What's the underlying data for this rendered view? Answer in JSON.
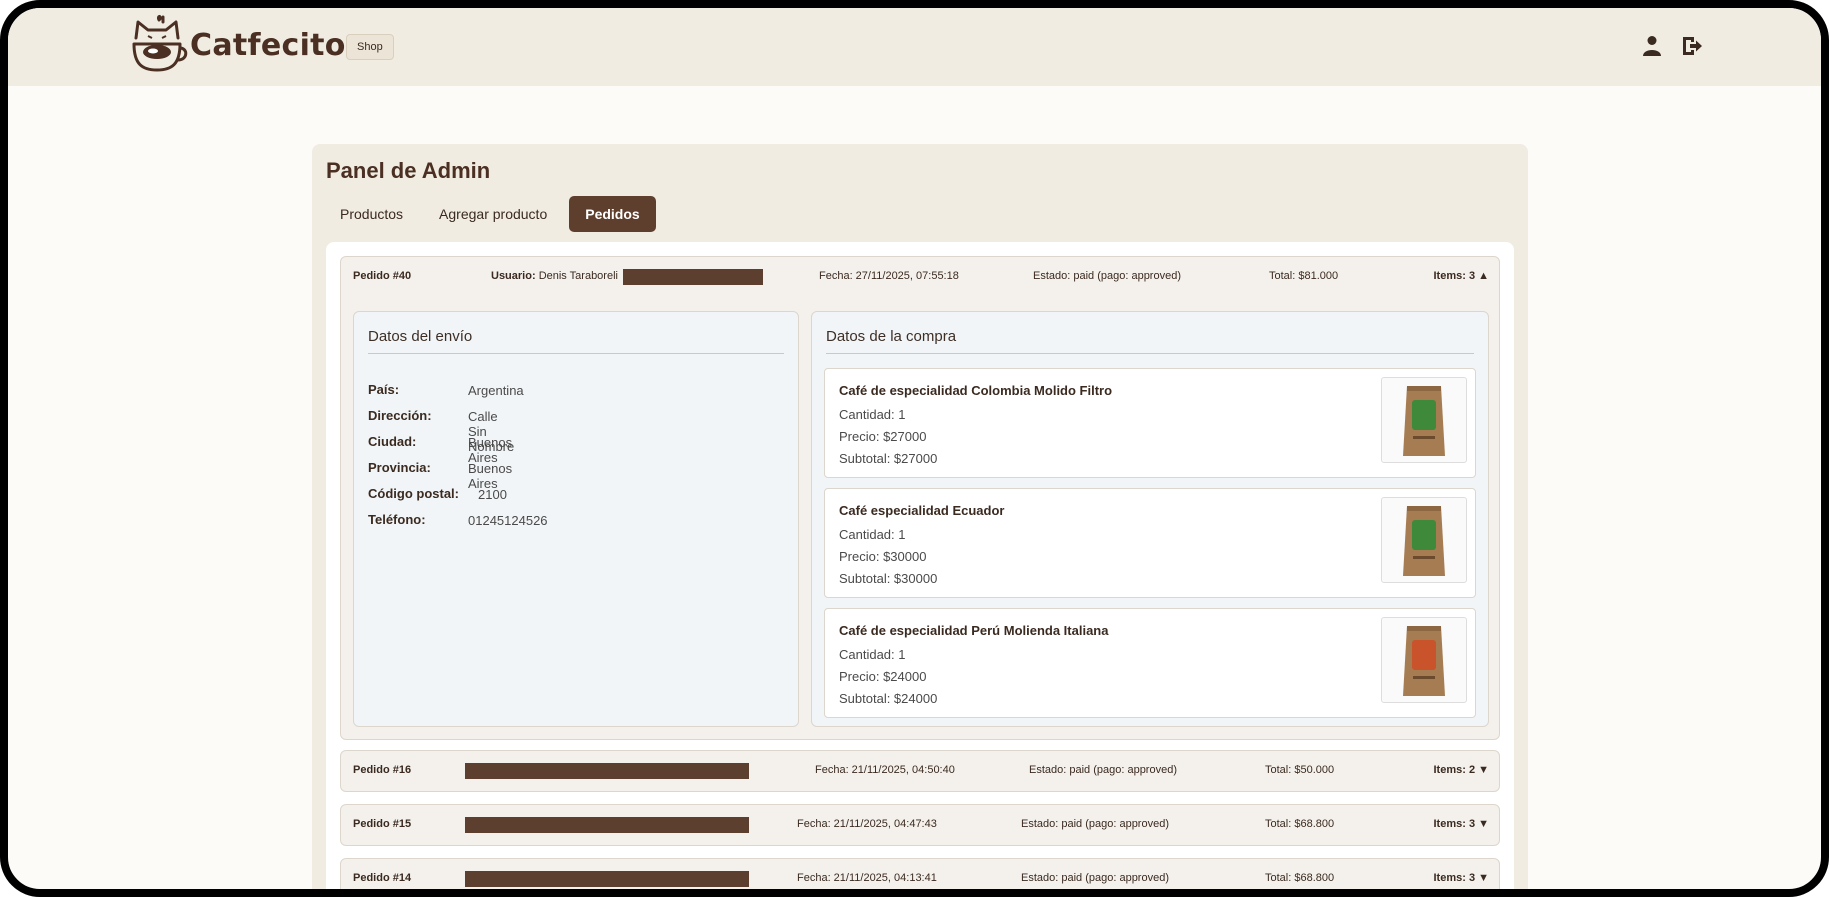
{
  "brand": {
    "name": "Catfecito"
  },
  "nav": {
    "shop_label": "Shop",
    "user_icon": "user-icon",
    "logout_icon": "logout-icon"
  },
  "panel": {
    "title": "Panel de Admin",
    "tabs": [
      {
        "label": "Productos",
        "active": false
      },
      {
        "label": "Agregar producto",
        "active": false
      },
      {
        "label": "Pedidos",
        "active": true
      }
    ]
  },
  "orders": [
    {
      "id": "Pedido #40",
      "user_label": "Usuario:",
      "user_name": "Denis Taraboreli",
      "date": "Fecha: 27/11/2025, 07:55:18",
      "status": "Estado: paid (pago: approved)",
      "total": "Total: $81.000",
      "items": "Items: 3 ▲",
      "expanded": true,
      "shipping": {
        "title": "Datos del envío",
        "rows": [
          {
            "label": "País:",
            "value": "Argentina"
          },
          {
            "label": "Dirección:",
            "value": "Calle Sin Nombre"
          },
          {
            "label": "Ciudad:",
            "value": "Buenos Aires"
          },
          {
            "label": "Provincia:",
            "value": "Buenos Aires"
          },
          {
            "label": "Código postal:",
            "value": "2100"
          },
          {
            "label": "Teléfono:",
            "value": "01245124526"
          }
        ]
      },
      "purchase": {
        "title": "Datos de la compra",
        "items": [
          {
            "name": "Café de especialidad Colombia Molido Filtro",
            "qty": "Cantidad: 1",
            "price": "Precio: $27000",
            "subtotal": "Subtotal: $27000",
            "label_color": "#3f8a3a"
          },
          {
            "name": "Café especialidad Ecuador",
            "qty": "Cantidad: 1",
            "price": "Precio: $30000",
            "subtotal": "Subtotal: $30000",
            "label_color": "#3f8a3a"
          },
          {
            "name": "Café de especialidad Perú Molienda Italiana",
            "qty": "Cantidad: 1",
            "price": "Precio: $24000",
            "subtotal": "Subtotal: $24000",
            "label_color": "#c9532a"
          }
        ]
      }
    },
    {
      "id": "Pedido #16",
      "date": "Fecha: 21/11/2025, 04:50:40",
      "status": "Estado: paid (pago: approved)",
      "total": "Total: $50.000",
      "items": "Items: 2 ▼",
      "expanded": false
    },
    {
      "id": "Pedido #15",
      "date": "Fecha: 21/11/2025, 04:47:43",
      "status": "Estado: paid (pago: approved)",
      "total": "Total: $68.800",
      "items": "Items: 3 ▼",
      "expanded": false
    },
    {
      "id": "Pedido #14",
      "date": "Fecha: 21/11/2025, 04:13:41",
      "status": "Estado: paid (pago: approved)",
      "total": "Total: $68.800",
      "items": "Items: 3 ▼",
      "expanded": false
    }
  ],
  "colors": {
    "accent": "#5e3e2c",
    "navbar": "#f1ece2",
    "redaction": "#5c3f2e"
  }
}
